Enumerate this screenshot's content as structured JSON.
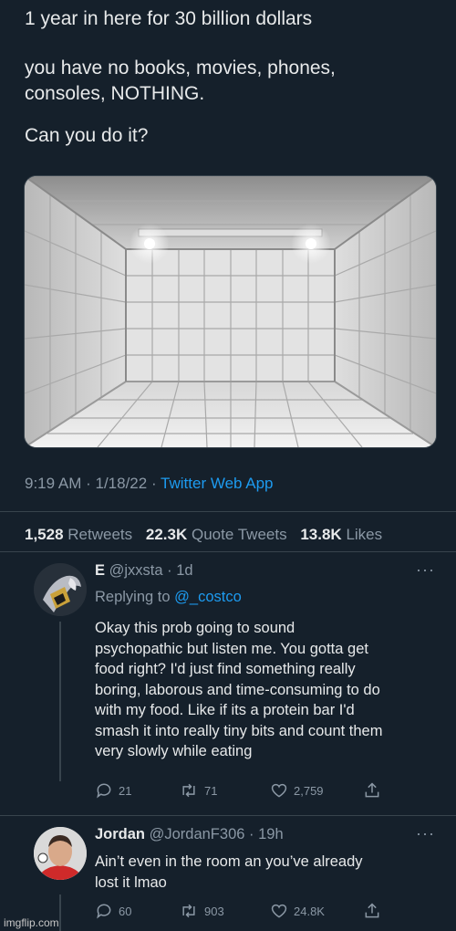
{
  "tweet": {
    "line1": "1 year in here for 30 billion dollars",
    "line2a": "you have no books, movies, phones,",
    "line2b": "consoles, NOTHING.",
    "line3": "Can you do it?",
    "time": "9:19 AM",
    "date": "1/18/22",
    "app": "Twitter Web App",
    "retweets": "1,528",
    "retweets_label": "Retweets",
    "quotes": "22.3K",
    "quotes_label": "Quote Tweets",
    "likes": "13.8K",
    "likes_label": "Likes"
  },
  "replies": [
    {
      "name": "E",
      "handle": "@jxxsta",
      "age": "1d",
      "replying_label": "Replying to",
      "replying_to": "@_costco",
      "lines": [
        "Okay this prob going to sound",
        "psychopathic but listen me. You gotta get",
        "food right? I'd just find something really",
        "boring, laborous and time-consuming to do",
        "with my food. Like if its a protein bar I'd",
        "smash it into really tiny bits and count them",
        "very slowly while eating"
      ],
      "reply_count": "21",
      "retweet_count": "71",
      "like_count": "2,759"
    },
    {
      "name": "Jordan",
      "handle": "@JordanF306",
      "age": "19h",
      "lines": [
        "Ain’t even in the room an you’ve already",
        "lost it lmao"
      ],
      "reply_count": "60",
      "retweet_count": "903",
      "like_count": "24.8K"
    }
  ],
  "watermark": "imgflip.com",
  "icons": [
    "reply-icon",
    "retweet-icon",
    "like-icon",
    "share-icon",
    "more-icon"
  ],
  "colors": {
    "background": "#15202b",
    "link": "#1d9bf0",
    "muted": "#8b98a5",
    "text": "#e7e9ea"
  }
}
